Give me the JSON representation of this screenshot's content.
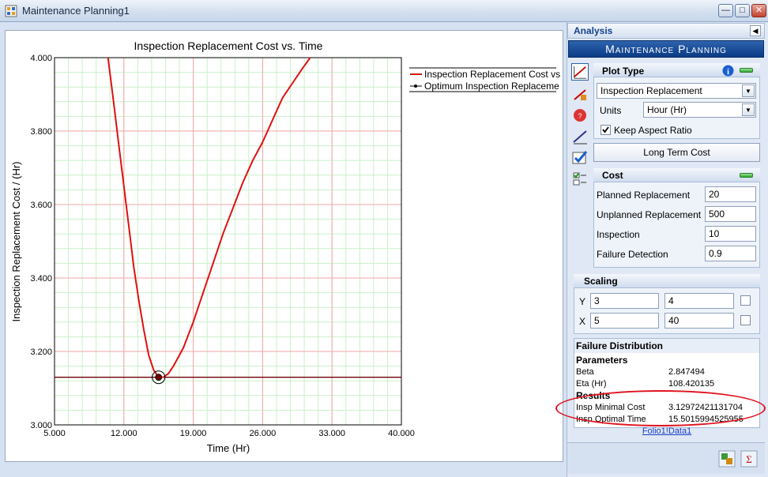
{
  "window": {
    "title": "Maintenance Planning1"
  },
  "chart_data": {
    "type": "line",
    "title": "Inspection Replacement Cost vs. Time",
    "xlabel": "Time (Hr)",
    "ylabel": "Inspection Replacement Cost / (Hr)",
    "xlim": [
      5,
      40
    ],
    "ylim": [
      3.0,
      4.0
    ],
    "x_ticks": [
      "5.000",
      "12.000",
      "19.000",
      "26.000",
      "33.000",
      "40.000"
    ],
    "y_ticks": [
      "3.000",
      "3.200",
      "3.400",
      "3.600",
      "3.800",
      "4.000"
    ],
    "legend_placement": "top-right outside",
    "series": [
      {
        "name": "Inspection Replacement Cost vs",
        "color": "#e01010",
        "points": [
          [
            10.4,
            4.0
          ],
          [
            11.0,
            3.87
          ],
          [
            11.5,
            3.76
          ],
          [
            12.0,
            3.65
          ],
          [
            12.5,
            3.54
          ],
          [
            13.0,
            3.43
          ],
          [
            13.5,
            3.34
          ],
          [
            14.0,
            3.26
          ],
          [
            14.5,
            3.19
          ],
          [
            15.0,
            3.15
          ],
          [
            15.5,
            3.13
          ],
          [
            16.0,
            3.13
          ],
          [
            16.5,
            3.14
          ],
          [
            17.0,
            3.16
          ],
          [
            18.0,
            3.21
          ],
          [
            19.0,
            3.28
          ],
          [
            20.0,
            3.36
          ],
          [
            21.0,
            3.44
          ],
          [
            22.0,
            3.52
          ],
          [
            23.0,
            3.59
          ],
          [
            24.0,
            3.66
          ],
          [
            25.0,
            3.72
          ],
          [
            26.0,
            3.77
          ],
          [
            27.0,
            3.83
          ],
          [
            28.0,
            3.89
          ],
          [
            29.0,
            3.93
          ],
          [
            30.0,
            3.97
          ],
          [
            30.8,
            4.0
          ]
        ]
      },
      {
        "name": "Optimum Inspection Replaceme",
        "color": "#6b0000",
        "hline_y": 3.1297,
        "marker": [
          15.5,
          3.1297
        ]
      }
    ]
  },
  "analysis": {
    "header": "Analysis",
    "banner": "Maintenance Planning",
    "plot_type": {
      "title": "Plot Type",
      "selected": "Inspection Replacement",
      "units_label": "Units",
      "units_value": "Hour (Hr)",
      "keep_aspect": "Keep Aspect Ratio",
      "long_term_button": "Long Term Cost"
    },
    "cost": {
      "title": "Cost",
      "fields": [
        {
          "label": "Planned Replacement",
          "value": "20"
        },
        {
          "label": "Unplanned Replacement",
          "value": "500"
        },
        {
          "label": "Inspection",
          "value": "10"
        },
        {
          "label": "Failure Detection",
          "value": "0.9"
        }
      ]
    },
    "scaling": {
      "title": "Scaling",
      "y_label": "Y",
      "y_min": "3",
      "y_max": "4",
      "x_label": "X",
      "x_min": "5",
      "x_max": "40"
    },
    "failure_distribution": {
      "title": "Failure Distribution",
      "params_title": "Parameters",
      "params": [
        {
          "label": "Beta",
          "value": "2.847494"
        },
        {
          "label": "Eta (Hr)",
          "value": "108.420135"
        }
      ],
      "results_title": "Results",
      "results": [
        {
          "label": "Insp Minimal Cost",
          "value": "3.12972421131704"
        },
        {
          "label": "Insp Optimal Time",
          "value": "15.5015994525955"
        }
      ]
    },
    "folio_link": "Folio1!Data1"
  }
}
